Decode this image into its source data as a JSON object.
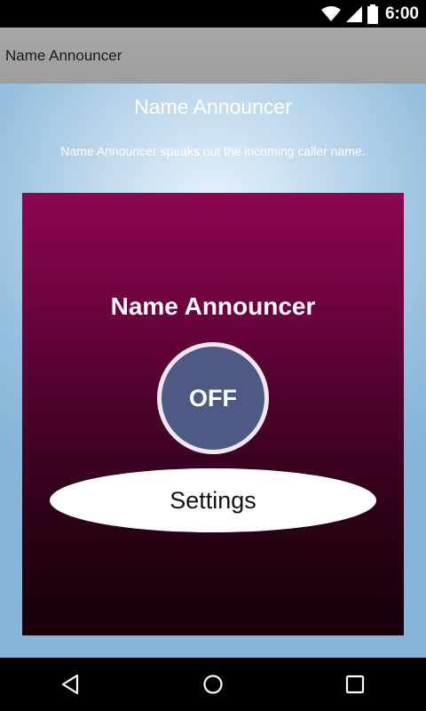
{
  "status_bar": {
    "time": "6:00",
    "icons": [
      "wifi-icon",
      "signal-icon",
      "battery-icon"
    ]
  },
  "action_bar": {
    "title": "Name Announcer"
  },
  "content": {
    "heading": "Name Announcer",
    "description": "Name Announcer speaks out the incoming caller name."
  },
  "panel": {
    "title": "Name Announcer",
    "toggle_label": "OFF",
    "settings_label": "Settings"
  },
  "nav_bar": {
    "icons": [
      "back-icon",
      "home-icon",
      "recents-icon"
    ]
  },
  "colors": {
    "panel_top": "#8c0552",
    "panel_bottom": "#16000b",
    "toggle_fill": "#4f5a84",
    "background_blue": "#94bedd"
  }
}
